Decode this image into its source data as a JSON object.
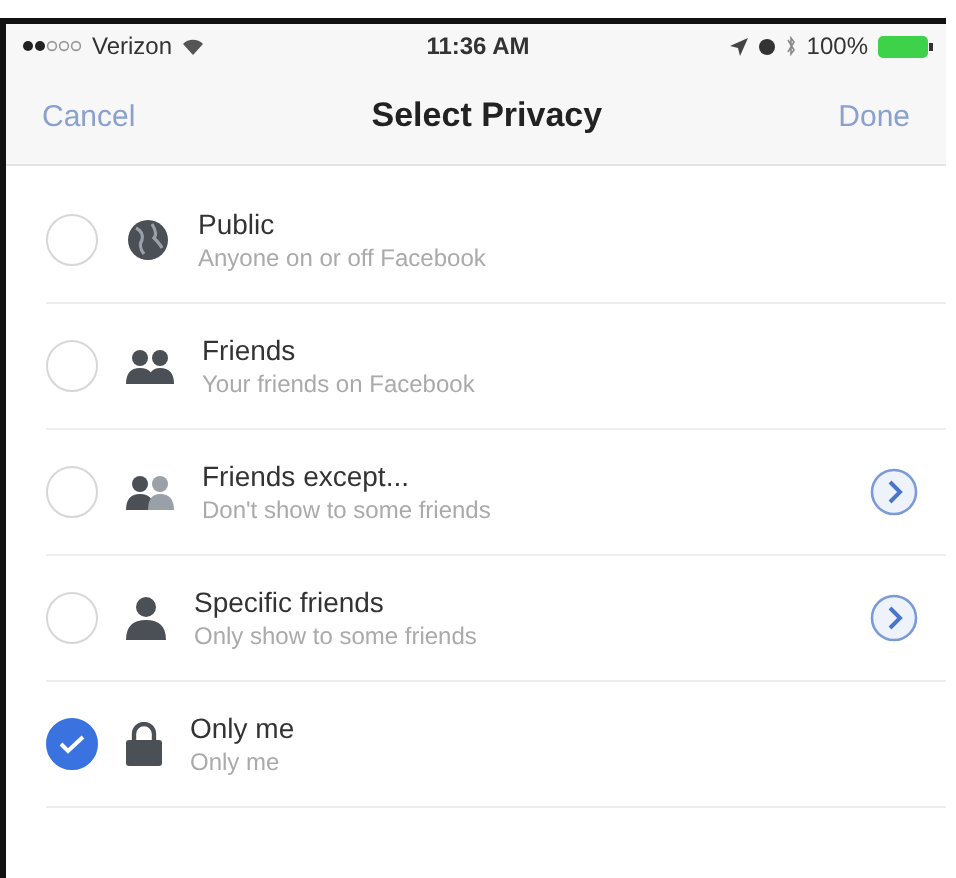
{
  "status_bar": {
    "carrier": "Verizon",
    "time": "11:36 AM",
    "battery": "100%"
  },
  "nav": {
    "cancel": "Cancel",
    "title": "Select Privacy",
    "done": "Done"
  },
  "options": [
    {
      "kind": "globe",
      "title": "Public",
      "subtitle": "Anyone on or off Facebook",
      "selected": false,
      "detail": false
    },
    {
      "kind": "friends",
      "title": "Friends",
      "subtitle": "Your friends on Facebook",
      "selected": false,
      "detail": false
    },
    {
      "kind": "friends-except",
      "title": "Friends except...",
      "subtitle": "Don't show to some friends",
      "selected": false,
      "detail": true
    },
    {
      "kind": "person",
      "title": "Specific friends",
      "subtitle": "Only show to some friends",
      "selected": false,
      "detail": true
    },
    {
      "kind": "lock",
      "title": "Only me",
      "subtitle": "Only me",
      "selected": true,
      "detail": false
    }
  ]
}
